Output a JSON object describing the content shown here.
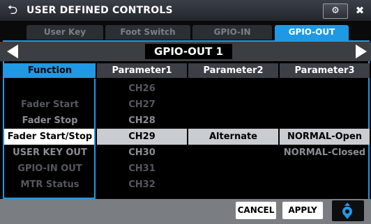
{
  "window": {
    "title": "USER DEFINED CONTROLS"
  },
  "tabs": [
    {
      "label": "User Key"
    },
    {
      "label": "Foot Switch"
    },
    {
      "label": "GPIO-IN"
    },
    {
      "label": "GPIO-OUT"
    }
  ],
  "active_tab": "GPIO-OUT",
  "nav": {
    "page_name": "GPIO-OUT 1"
  },
  "columns": {
    "function": "Function",
    "param1": "Parameter1",
    "param2": "Parameter2",
    "param3": "Parameter3"
  },
  "rows": [
    {
      "function": "",
      "param1": "CH26",
      "param2": "",
      "param3": ""
    },
    {
      "function": "Fader Start",
      "param1": "CH27",
      "param2": "",
      "param3": ""
    },
    {
      "function": "Fader Stop",
      "param1": "CH28",
      "param2": "",
      "param3": ""
    },
    {
      "function": "Fader Start/Stop",
      "param1": "CH29",
      "param2": "Alternate",
      "param3": "NORMAL-Open"
    },
    {
      "function": "USER KEY OUT",
      "param1": "CH30",
      "param2": "",
      "param3": "NORMAL-Closed"
    },
    {
      "function": "GPIO-IN OUT",
      "param1": "CH31",
      "param2": "",
      "param3": ""
    },
    {
      "function": "MTR Status",
      "param1": "CH32",
      "param2": "",
      "param3": ""
    }
  ],
  "buttons": {
    "cancel": "CANCEL",
    "apply": "APPLY"
  },
  "colors": {
    "accent": "#1f99e4",
    "selected_row": "#c9ccd1"
  }
}
